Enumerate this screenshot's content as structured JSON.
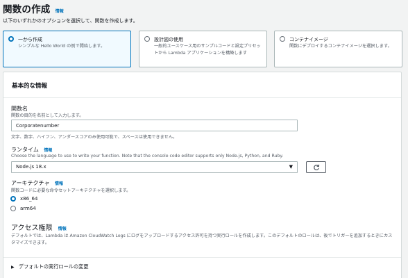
{
  "header": {
    "title": "関数の作成",
    "info": "情報",
    "subtitle": "以下のいずれかのオプションを選択して、関数を作成します。"
  },
  "options": [
    {
      "title": "一から作成",
      "desc": "シンプルな Hello World の例で開始します。",
      "selected": true
    },
    {
      "title": "設計図の使用",
      "desc": "一般的ユースケース用のサンプルコードと設定プリセットから Lambda アプリケーションを構築します",
      "selected": false
    },
    {
      "title": "コンテナイメージ",
      "desc": "関数にデプロイするコンテナイメージを選択します。",
      "selected": false
    }
  ],
  "basic": {
    "heading": "基本的な情報",
    "function_name": {
      "label": "関数名",
      "desc": "関数の目的を名前として入力します。",
      "value": "Corporatenumber",
      "hint": "文字、数字、ハイフン、アンダースコアのみ使用可能で、スペースは使用できません。"
    },
    "runtime": {
      "label": "ランタイム",
      "info": "情報",
      "desc": "Choose the language to use to write your function. Note that the console code editor supports only Node.js, Python, and Ruby.",
      "value": "Node.js 18.x"
    },
    "architecture": {
      "label": "アーキテクチャ",
      "info": "情報",
      "desc": "関数コードに必要な命令セットアーキテクチャを選択します。",
      "options": [
        "x86_64",
        "arm64"
      ],
      "selected": "x86_64"
    },
    "permissions": {
      "label": "アクセス権限",
      "info": "情報",
      "desc": "デフォルトでは、Lambda は Amazon CloudWatch Logs にログをアップロードするアクセス許可を持つ実行ロールを作成します。このデフォルトのロールは、後でトリガーを追加するときにカスタマイズできます。",
      "expander": "デフォルトの実行ロールの変更"
    }
  }
}
